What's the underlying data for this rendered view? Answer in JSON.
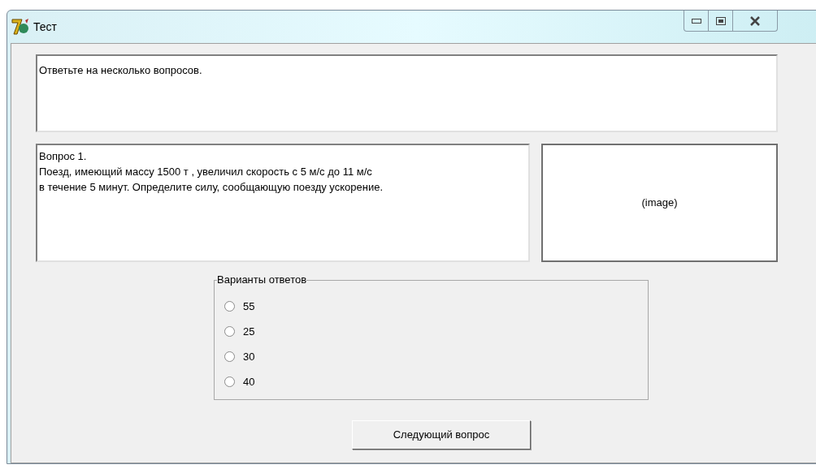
{
  "window": {
    "title": "Тест"
  },
  "intro": {
    "text": "Ответьте на несколько вопросов."
  },
  "question": {
    "lines": [
      "Вопрос 1.",
      "Поезд, имеющий массу 1500 т , увеличил скорость с 5 м/с до 11 м/с",
      "в течение 5 минут. Определите силу, сообщающую поезду ускорение."
    ]
  },
  "image_box": {
    "text": "(image)"
  },
  "answers": {
    "title": "Варианты ответов",
    "options": [
      {
        "label": "55",
        "selected": false
      },
      {
        "label": "25",
        "selected": false
      },
      {
        "label": "30",
        "selected": false
      },
      {
        "label": "40",
        "selected": false
      }
    ]
  },
  "buttons": [
    {
      "label": "Следующий вопрос"
    }
  ]
}
